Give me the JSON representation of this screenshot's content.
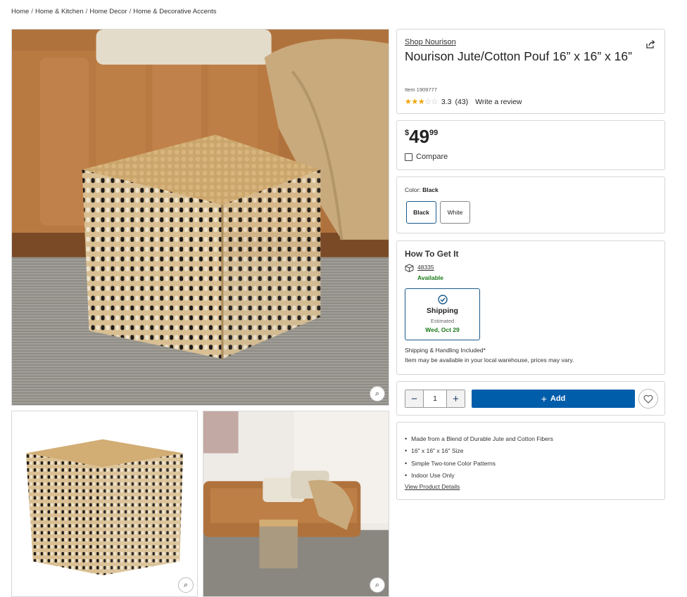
{
  "breadcrumb": [
    "Home",
    "Home & Kitchen",
    "Home Decor",
    "Home & Decorative Accents"
  ],
  "product": {
    "brand_link": "Shop Nourison",
    "title": "Nourison Jute/Cotton Pouf 16” x 16” x 16”",
    "item_number": "Item 1909777",
    "rating_value": 3.3,
    "rating_text": "3.3",
    "review_count": "(43)",
    "write_review": "Write a review",
    "share_icon": "share-icon"
  },
  "price": {
    "currency": "$",
    "whole": "49",
    "cents": "99",
    "compare_label": "Compare"
  },
  "color": {
    "label": "Color:",
    "selected": "Black",
    "options": [
      "Black",
      "White"
    ]
  },
  "fulfillment": {
    "heading": "How To Get It",
    "zip": "48335",
    "availability": "Available",
    "shipping_label": "Shipping",
    "estimated_label": "Estimated",
    "delivery_date": "Wed, Oct 29",
    "note_1": "Shipping & Handling Included*",
    "note_2": "Item may be available in your local warehouse, prices may vary."
  },
  "cart": {
    "quantity": "1",
    "add_label": "Add"
  },
  "features": {
    "items": [
      "Made from a Blend of Durable Jute and Cotton Fibers",
      "16\" x 16\" x 16\" Size",
      "Simple Two-tone Color Patterns",
      "Indoor Use Only"
    ],
    "details_link": "View Product Details"
  },
  "colors": {
    "accent_blue": "#005daa",
    "selected_border": "#1a5a8a",
    "available_green": "#1a7a1a",
    "star_gold": "#f0a500"
  }
}
